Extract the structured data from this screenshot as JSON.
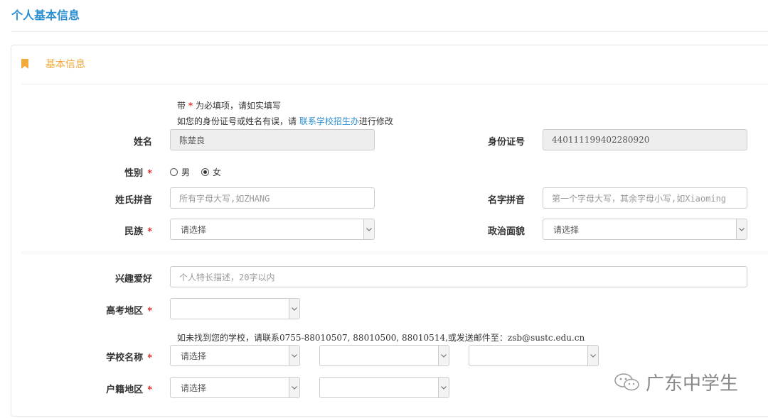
{
  "page": {
    "title": "个人基本信息"
  },
  "section": {
    "title": "基本信息"
  },
  "notes": {
    "required_prefix": "带",
    "required_star": "*",
    "required_suffix": "为必填项，请如实填写",
    "error_prefix": "如您的身份证号或姓名有误，请",
    "error_link": "联系学校招生办",
    "error_suffix": "进行修改",
    "school_help": "如未找到您的学校，请联系0755-88010507, 88010500, 88010514,或发送邮件至：zsb@sustc.edu.cn"
  },
  "fields": {
    "name": {
      "label": "姓名",
      "value": "陈楚良"
    },
    "id_number": {
      "label": "身份证号",
      "value": "440111199402280920"
    },
    "gender": {
      "label": "性别",
      "options": [
        "男",
        "女"
      ],
      "selected": "女"
    },
    "surname_pinyin": {
      "label": "姓氏拼音",
      "placeholder": "所有字母大写,如ZHANG"
    },
    "given_pinyin": {
      "label": "名字拼音",
      "placeholder": "第一个字母大写，其余字母小写,如Xiaoming"
    },
    "ethnicity": {
      "label": "民族",
      "value": "请选择"
    },
    "political_status": {
      "label": "政治面貌",
      "value": "请选择"
    },
    "hobbies": {
      "label": "兴趣爱好",
      "placeholder": "个人特长描述，20字以内"
    },
    "exam_region": {
      "label": "高考地区",
      "value": ""
    },
    "school_name": {
      "label": "学校名称",
      "value1": "请选择",
      "value2": "",
      "value3": ""
    },
    "household_region": {
      "label": "户籍地区",
      "value1": "请选择",
      "value2": ""
    }
  },
  "required_mark": "*",
  "watermark": {
    "text": "广东中学生"
  },
  "colors": {
    "accent": "#2a8fd0",
    "section": "#f0a93a",
    "required": "#e02020"
  }
}
